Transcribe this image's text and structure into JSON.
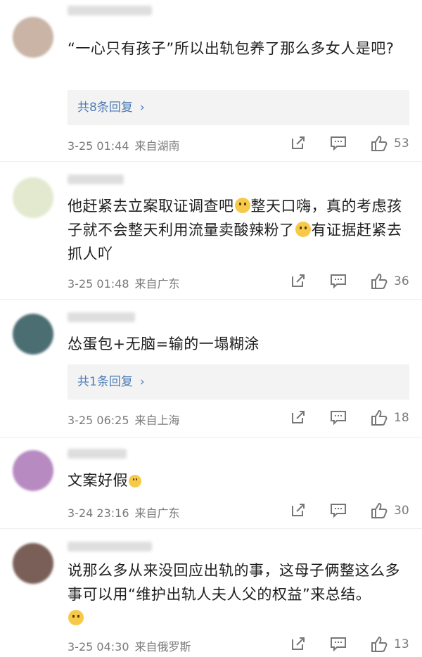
{
  "comments": [
    {
      "text": "“一心只有孩子”所以出轨包养了那么多女人是吧?",
      "reply_label": "共8条回复",
      "date": "3-25 01:44",
      "location": "来自湖南",
      "likes": "53",
      "avatar_color": "#c9b4a6"
    },
    {
      "text_parts": [
        "他赶紧去立案取证调查吧",
        "整天口嗨，真的考虑孩子就不会整天利用流量卖酸辣粉了",
        "有证据赶紧去抓人吖"
      ],
      "date": "3-25 01:48",
      "location": "来自广东",
      "likes": "36",
      "avatar_color": "#e3e9cf"
    },
    {
      "text": "怂蛋包+无脑=输的一塌糊涂",
      "reply_label": "共1条回复",
      "date": "3-25 06:25",
      "location": "来自上海",
      "likes": "18",
      "avatar_color": "#4b6e73"
    },
    {
      "text": "文案好假",
      "date": "3-24 23:16",
      "location": "来自广东",
      "likes": "30",
      "avatar_color": "#b78ac2"
    },
    {
      "text": "说那么多从来没回应出轨的事，这母子俩整这么多事可以用“维护出轨人夫人父的权益”来总结。",
      "date": "3-25 04:30",
      "location": "来自俄罗斯",
      "likes": "13",
      "avatar_color": "#7a5f58"
    }
  ],
  "icons": [
    "share-icon",
    "comment-icon",
    "like-icon",
    "chevron-right-icon"
  ],
  "colors": {
    "link": "#4d7cb7",
    "meta": "#7a7a7a",
    "reply_bg": "#f3f3f3"
  }
}
